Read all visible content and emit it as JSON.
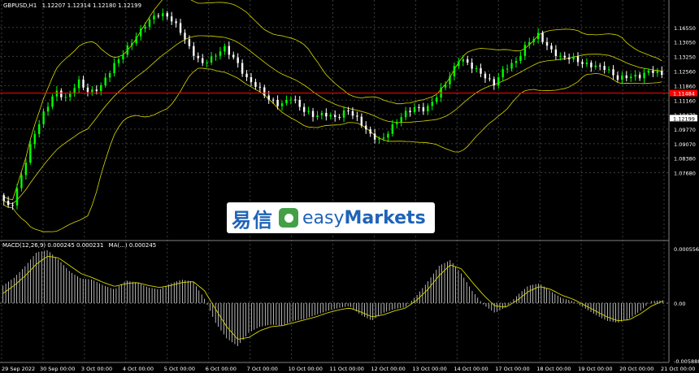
{
  "chart_data": [
    {
      "type": "candlestick",
      "symbol_header": "GBPUSD,H1",
      "ohlc_header": "1.12207 1.12314 1.12180 1.12199",
      "ylim": [
        1.064,
        1.174
      ],
      "y_ticks": [
        "1.16550",
        "1.13050",
        "1.13250",
        "1.12560",
        "1.11860",
        "1.11160",
        "1.10470",
        "1.09770",
        "1.09070",
        "1.08380",
        "1.07680"
      ],
      "y_tick_values": [
        1.1655,
        1.1585,
        1.1516,
        1.1446,
        1.1376,
        1.1306,
        1.1237,
        1.1167,
        1.1097,
        1.1028,
        1.0958
      ],
      "current_price_label": "1.12199",
      "current_price": 1.12199,
      "red_line_label": "1.11484",
      "red_line_price": 1.134,
      "x_labels": [
        "29 Sep 2022",
        "30 Sep 00:00",
        "3 Oct 00:00",
        "4 Oct 00:00",
        "5 Oct 00:00",
        "6 Oct 00:00",
        "7 Oct 00:00",
        "10 Oct 00:00",
        "11 Oct 00:00",
        "12 Oct 00:00",
        "13 Oct 00:00",
        "14 Oct 00:00",
        "17 Oct 00:00",
        "18 Oct 00:00",
        "19 Oct 00:00",
        "20 Oct 00:00",
        "21 Oct 00:00"
      ],
      "close_path": [
        1.085,
        1.078,
        1.095,
        1.113,
        1.125,
        1.135,
        1.131,
        1.14,
        1.134,
        1.137,
        1.146,
        1.153,
        1.16,
        1.167,
        1.172,
        1.171,
        1.165,
        1.155,
        1.148,
        1.151,
        1.156,
        1.15,
        1.141,
        1.137,
        1.131,
        1.128,
        1.132,
        1.126,
        1.123,
        1.124,
        1.122,
        1.126,
        1.121,
        1.114,
        1.111,
        1.118,
        1.124,
        1.127,
        1.126,
        1.133,
        1.141,
        1.151,
        1.147,
        1.143,
        1.138,
        1.146,
        1.149,
        1.158,
        1.162,
        1.155,
        1.151,
        1.151,
        1.148,
        1.147,
        1.146,
        1.141,
        1.142,
        1.142,
        1.145,
        1.143
      ],
      "indicators": [
        "Bollinger Bands",
        "Moving Average"
      ],
      "colors": {
        "bull": "#00ff00",
        "bear": "#ffffff",
        "band": "#d9d900",
        "price_line": "#ff0000",
        "grid": "#3c3c3c",
        "axis_text": "#ffffff"
      }
    },
    {
      "type": "histogram",
      "indicator_label": "MACD(12,26,9) 0.000245 0.000231",
      "signal_label": "MA(...) 0.000245",
      "ylim": [
        -0.00589,
        0.00556
      ],
      "y_ticks": [
        "0.000556",
        "0.00",
        "-0.005888"
      ],
      "y_tick_values": [
        0.00556,
        0.0,
        -0.00589
      ],
      "values": [
        0.0018,
        0.0026,
        0.0038,
        0.0052,
        0.0054,
        0.0044,
        0.0032,
        0.0025,
        0.0024,
        0.0018,
        0.0014,
        0.0023,
        0.0021,
        0.0016,
        0.0014,
        0.002,
        0.0024,
        0.0022,
        0.0005,
        -0.002,
        -0.0036,
        -0.0044,
        -0.003,
        -0.0024,
        -0.0022,
        -0.0023,
        -0.0018,
        -0.0016,
        -0.0012,
        -0.0008,
        -0.0005,
        -0.0003,
        -0.0012,
        -0.0018,
        -0.001,
        -0.0006,
        -0.0004,
        0.0008,
        0.0022,
        0.0038,
        0.0044,
        0.003,
        0.0012,
        -0.0002,
        -0.001,
        -0.0004,
        0.0008,
        0.0018,
        0.002,
        0.0012,
        0.0005,
        0.0002,
        -0.0005,
        -0.0012,
        -0.0018,
        -0.002,
        -0.0016,
        -0.0008,
        0.0002,
        0.0003
      ],
      "signal": [
        0.001,
        0.0018,
        0.0028,
        0.004,
        0.0048,
        0.0046,
        0.0038,
        0.003,
        0.0026,
        0.0021,
        0.0017,
        0.002,
        0.0021,
        0.0018,
        0.0016,
        0.0018,
        0.0021,
        0.0022,
        0.0013,
        -0.0006,
        -0.0024,
        -0.0037,
        -0.0035,
        -0.0028,
        -0.0024,
        -0.0023,
        -0.002,
        -0.0017,
        -0.0014,
        -0.001,
        -0.0007,
        -0.0005,
        -0.0009,
        -0.0014,
        -0.0012,
        -0.0008,
        -0.0005,
        0.0003,
        0.0014,
        0.0028,
        0.0039,
        0.0035,
        0.0021,
        0.0008,
        -0.0003,
        -0.0004,
        0.0003,
        0.0012,
        0.0017,
        0.0014,
        0.0008,
        0.0004,
        -0.0002,
        -0.0008,
        -0.0014,
        -0.0018,
        -0.0017,
        -0.0011,
        -0.0003,
        0.0002
      ],
      "colors": {
        "bar": "#ffffff",
        "signal": "#d9d900"
      }
    }
  ],
  "logo": {
    "cn_text": "易信",
    "en_text_a": "easy",
    "en_text_b": "Markets"
  }
}
